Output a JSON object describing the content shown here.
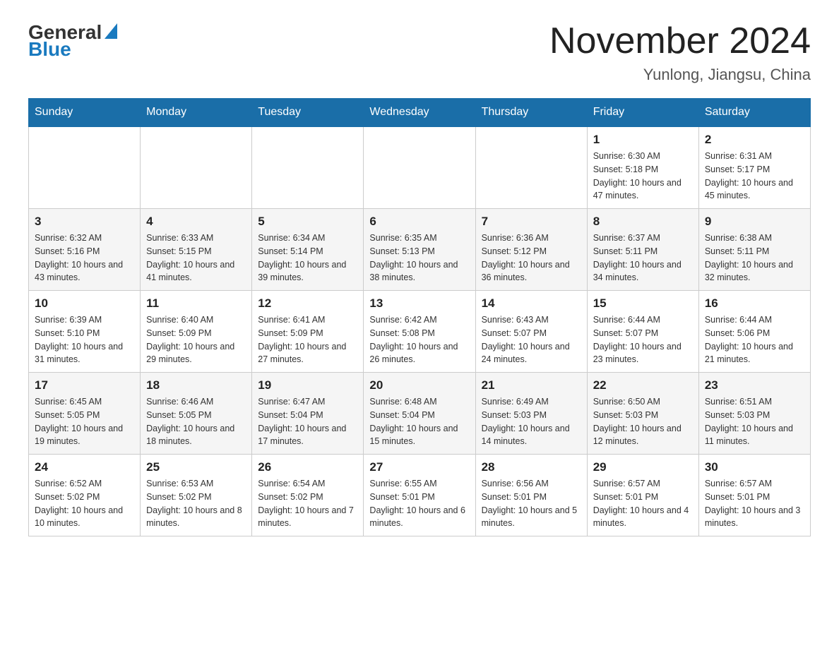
{
  "header": {
    "logo_general": "General",
    "logo_blue": "Blue",
    "title": "November 2024",
    "subtitle": "Yunlong, Jiangsu, China"
  },
  "weekdays": [
    "Sunday",
    "Monday",
    "Tuesday",
    "Wednesday",
    "Thursday",
    "Friday",
    "Saturday"
  ],
  "weeks": [
    [
      {
        "day": "",
        "info": ""
      },
      {
        "day": "",
        "info": ""
      },
      {
        "day": "",
        "info": ""
      },
      {
        "day": "",
        "info": ""
      },
      {
        "day": "",
        "info": ""
      },
      {
        "day": "1",
        "info": "Sunrise: 6:30 AM\nSunset: 5:18 PM\nDaylight: 10 hours and 47 minutes."
      },
      {
        "day": "2",
        "info": "Sunrise: 6:31 AM\nSunset: 5:17 PM\nDaylight: 10 hours and 45 minutes."
      }
    ],
    [
      {
        "day": "3",
        "info": "Sunrise: 6:32 AM\nSunset: 5:16 PM\nDaylight: 10 hours and 43 minutes."
      },
      {
        "day": "4",
        "info": "Sunrise: 6:33 AM\nSunset: 5:15 PM\nDaylight: 10 hours and 41 minutes."
      },
      {
        "day": "5",
        "info": "Sunrise: 6:34 AM\nSunset: 5:14 PM\nDaylight: 10 hours and 39 minutes."
      },
      {
        "day": "6",
        "info": "Sunrise: 6:35 AM\nSunset: 5:13 PM\nDaylight: 10 hours and 38 minutes."
      },
      {
        "day": "7",
        "info": "Sunrise: 6:36 AM\nSunset: 5:12 PM\nDaylight: 10 hours and 36 minutes."
      },
      {
        "day": "8",
        "info": "Sunrise: 6:37 AM\nSunset: 5:11 PM\nDaylight: 10 hours and 34 minutes."
      },
      {
        "day": "9",
        "info": "Sunrise: 6:38 AM\nSunset: 5:11 PM\nDaylight: 10 hours and 32 minutes."
      }
    ],
    [
      {
        "day": "10",
        "info": "Sunrise: 6:39 AM\nSunset: 5:10 PM\nDaylight: 10 hours and 31 minutes."
      },
      {
        "day": "11",
        "info": "Sunrise: 6:40 AM\nSunset: 5:09 PM\nDaylight: 10 hours and 29 minutes."
      },
      {
        "day": "12",
        "info": "Sunrise: 6:41 AM\nSunset: 5:09 PM\nDaylight: 10 hours and 27 minutes."
      },
      {
        "day": "13",
        "info": "Sunrise: 6:42 AM\nSunset: 5:08 PM\nDaylight: 10 hours and 26 minutes."
      },
      {
        "day": "14",
        "info": "Sunrise: 6:43 AM\nSunset: 5:07 PM\nDaylight: 10 hours and 24 minutes."
      },
      {
        "day": "15",
        "info": "Sunrise: 6:44 AM\nSunset: 5:07 PM\nDaylight: 10 hours and 23 minutes."
      },
      {
        "day": "16",
        "info": "Sunrise: 6:44 AM\nSunset: 5:06 PM\nDaylight: 10 hours and 21 minutes."
      }
    ],
    [
      {
        "day": "17",
        "info": "Sunrise: 6:45 AM\nSunset: 5:05 PM\nDaylight: 10 hours and 19 minutes."
      },
      {
        "day": "18",
        "info": "Sunrise: 6:46 AM\nSunset: 5:05 PM\nDaylight: 10 hours and 18 minutes."
      },
      {
        "day": "19",
        "info": "Sunrise: 6:47 AM\nSunset: 5:04 PM\nDaylight: 10 hours and 17 minutes."
      },
      {
        "day": "20",
        "info": "Sunrise: 6:48 AM\nSunset: 5:04 PM\nDaylight: 10 hours and 15 minutes."
      },
      {
        "day": "21",
        "info": "Sunrise: 6:49 AM\nSunset: 5:03 PM\nDaylight: 10 hours and 14 minutes."
      },
      {
        "day": "22",
        "info": "Sunrise: 6:50 AM\nSunset: 5:03 PM\nDaylight: 10 hours and 12 minutes."
      },
      {
        "day": "23",
        "info": "Sunrise: 6:51 AM\nSunset: 5:03 PM\nDaylight: 10 hours and 11 minutes."
      }
    ],
    [
      {
        "day": "24",
        "info": "Sunrise: 6:52 AM\nSunset: 5:02 PM\nDaylight: 10 hours and 10 minutes."
      },
      {
        "day": "25",
        "info": "Sunrise: 6:53 AM\nSunset: 5:02 PM\nDaylight: 10 hours and 8 minutes."
      },
      {
        "day": "26",
        "info": "Sunrise: 6:54 AM\nSunset: 5:02 PM\nDaylight: 10 hours and 7 minutes."
      },
      {
        "day": "27",
        "info": "Sunrise: 6:55 AM\nSunset: 5:01 PM\nDaylight: 10 hours and 6 minutes."
      },
      {
        "day": "28",
        "info": "Sunrise: 6:56 AM\nSunset: 5:01 PM\nDaylight: 10 hours and 5 minutes."
      },
      {
        "day": "29",
        "info": "Sunrise: 6:57 AM\nSunset: 5:01 PM\nDaylight: 10 hours and 4 minutes."
      },
      {
        "day": "30",
        "info": "Sunrise: 6:57 AM\nSunset: 5:01 PM\nDaylight: 10 hours and 3 minutes."
      }
    ]
  ]
}
